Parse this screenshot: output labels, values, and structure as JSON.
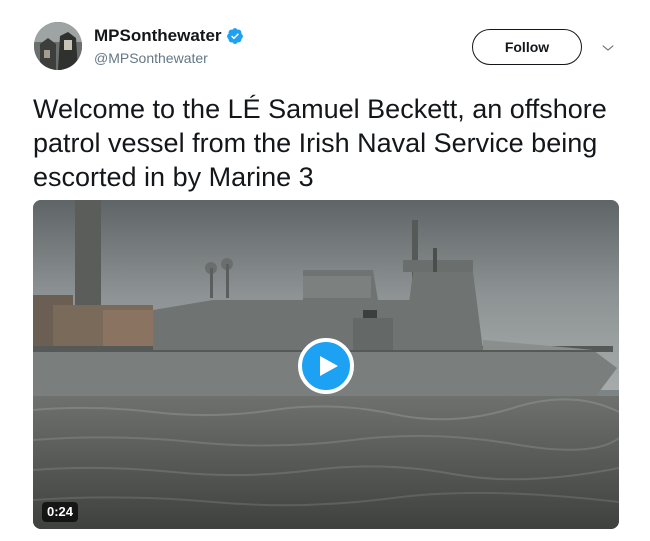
{
  "user": {
    "display_name": "MPSonthewater",
    "handle": "@MPSonthewater",
    "verified": true,
    "avatar_icon": "profile-photo"
  },
  "actions": {
    "follow_label": "Follow",
    "more_icon": "chevron-down-icon"
  },
  "tweet": {
    "text": "Welcome to the LÉ Samuel Beckett, an offshore patrol vessel from the Irish Naval Service being escorted in by Marine 3"
  },
  "media": {
    "type": "video",
    "duration": "0:24",
    "play_icon": "play-icon"
  },
  "colors": {
    "accent": "#1da1f2",
    "text": "#14171a",
    "secondary_text": "#657786"
  }
}
